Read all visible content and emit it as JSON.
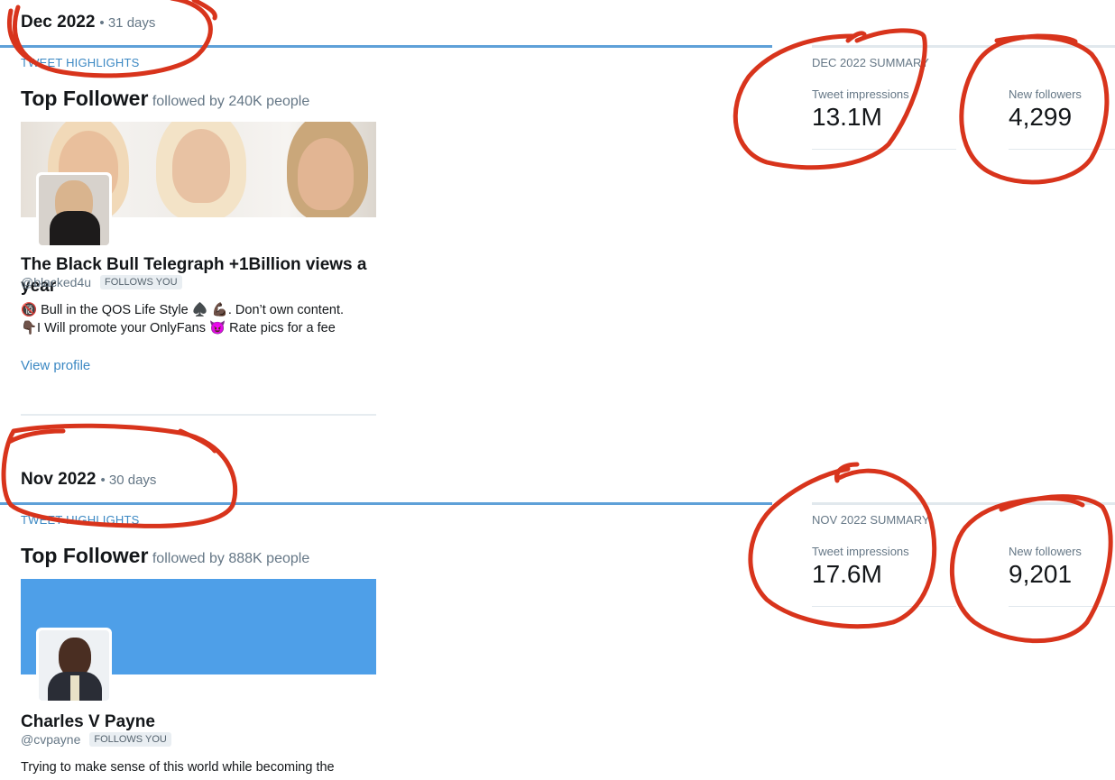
{
  "months": [
    {
      "name": "Dec 2022",
      "days": "• 31 days",
      "highlights_label": "TWEET HIGHLIGHTS",
      "summary_label": "DEC 2022 SUMMARY",
      "top_follower_title": "Top Follower",
      "top_follower_sub": "followed by 240K people",
      "user_name": "The Black Bull Telegraph +1Billion views a year",
      "handle": "@blacked4u",
      "follows_badge": "FOLLOWS YOU",
      "bio_line1": "🔞 Bull in the QOS Life Style ♠️ 💪🏿. Don’t own content.",
      "bio_line2": "👇🏿I Will promote your OnlyFans 😈 Rate pics for a fee",
      "view_profile": "View profile",
      "impressions_label": "Tweet impressions",
      "impressions_value": "13.1M",
      "followers_label": "New followers",
      "followers_value": "4,299"
    },
    {
      "name": "Nov 2022",
      "days": "• 30 days",
      "highlights_label": "TWEET HIGHLIGHTS",
      "summary_label": "NOV 2022 SUMMARY",
      "top_follower_title": "Top Follower",
      "top_follower_sub": "followed by 888K people",
      "user_name": "Charles V Payne",
      "handle": "@cvpayne",
      "follows_badge": "FOLLOWS YOU",
      "bio_line1": "Trying to make sense of this world while becoming the",
      "impressions_label": "Tweet impressions",
      "impressions_value": "17.6M",
      "followers_label": "New followers",
      "followers_value": "9,201"
    }
  ],
  "colors": {
    "accent_blue": "#3b88c3",
    "rule_blue": "#5ea0d8",
    "banner_blue": "#4e9fe8",
    "annotation_red": "#d8341c"
  }
}
